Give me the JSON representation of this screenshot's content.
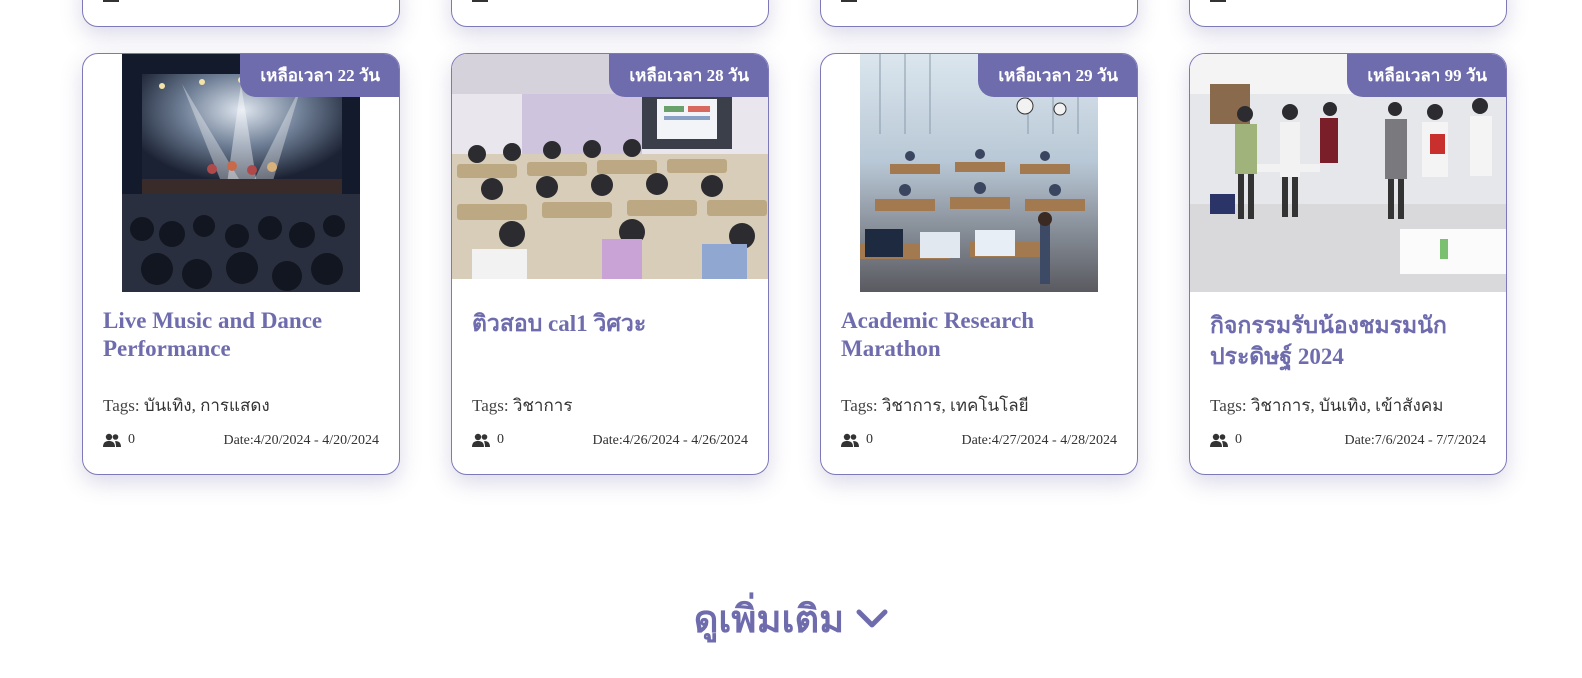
{
  "cards": [
    {
      "badge": "เหลือเวลา 22 วัน",
      "title": "Live Music and Dance Performance",
      "tags_label": "Tags:",
      "tags": "บันเทิง, การแสดง",
      "participants": "0",
      "date": "Date:4/20/2024 - 4/20/2024"
    },
    {
      "badge": "เหลือเวลา 28 วัน",
      "title": "ติวสอบ cal1 วิศวะ",
      "tags_label": "Tags:",
      "tags": "วิชาการ",
      "participants": "0",
      "date": "Date:4/26/2024 - 4/26/2024"
    },
    {
      "badge": "เหลือเวลา 29 วัน",
      "title": "Academic Research Marathon",
      "tags_label": "Tags:",
      "tags": "วิชาการ, เทคโนโลยี",
      "participants": "0",
      "date": "Date:4/27/2024 - 4/28/2024"
    },
    {
      "badge": "เหลือเวลา 99 วัน",
      "title": "กิจกรรมรับน้องชมรมนักประดิษฐ์ 2024",
      "tags_label": "Tags:",
      "tags": "วิชาการ, บันเทิง, เข้าสังคม",
      "participants": "0",
      "date": "Date:7/6/2024 - 7/7/2024"
    }
  ],
  "see_more": "ดูเพิ่มเติม",
  "icons": {
    "participants": "people-icon",
    "see_more": "chevron-down-icon"
  },
  "colors": {
    "accent": "#6f6cae",
    "card_border": "#7d79b8"
  }
}
